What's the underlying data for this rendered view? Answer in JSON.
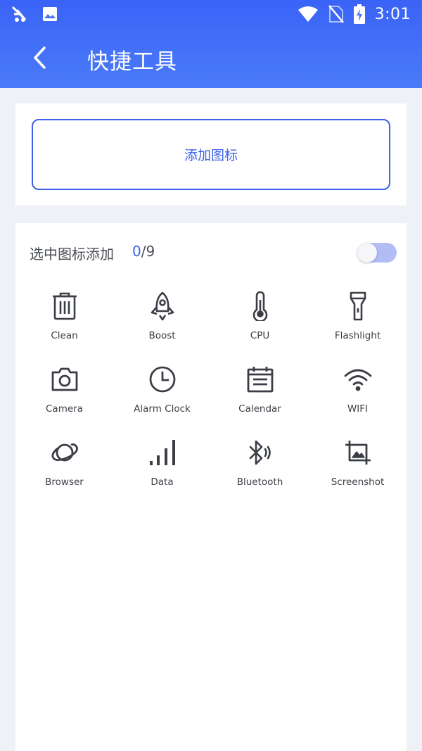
{
  "status_bar": {
    "time": "3:01"
  },
  "header": {
    "title": "快捷工具"
  },
  "add_button": {
    "label": "添加图标"
  },
  "selection": {
    "label": "选中图标添加",
    "current": "0",
    "total": "/9",
    "toggle_on": false
  },
  "tools": [
    {
      "label": "Clean",
      "icon": "trash-icon"
    },
    {
      "label": "Boost",
      "icon": "rocket-icon"
    },
    {
      "label": "CPU",
      "icon": "thermometer-icon"
    },
    {
      "label": "Flashlight",
      "icon": "flashlight-icon"
    },
    {
      "label": "Camera",
      "icon": "camera-icon"
    },
    {
      "label": "Alarm Clock",
      "icon": "clock-icon"
    },
    {
      "label": "Calendar",
      "icon": "calendar-icon"
    },
    {
      "label": "WIFI",
      "icon": "wifi-icon"
    },
    {
      "label": "Browser",
      "icon": "planet-icon"
    },
    {
      "label": "Data",
      "icon": "signal-bars-icon"
    },
    {
      "label": "Bluetooth",
      "icon": "bluetooth-icon"
    },
    {
      "label": "Screenshot",
      "icon": "screenshot-icon"
    }
  ],
  "colors": {
    "accent": "#3d61e8",
    "header": "#4170f8",
    "toggle_track": "#b3bdf5"
  }
}
